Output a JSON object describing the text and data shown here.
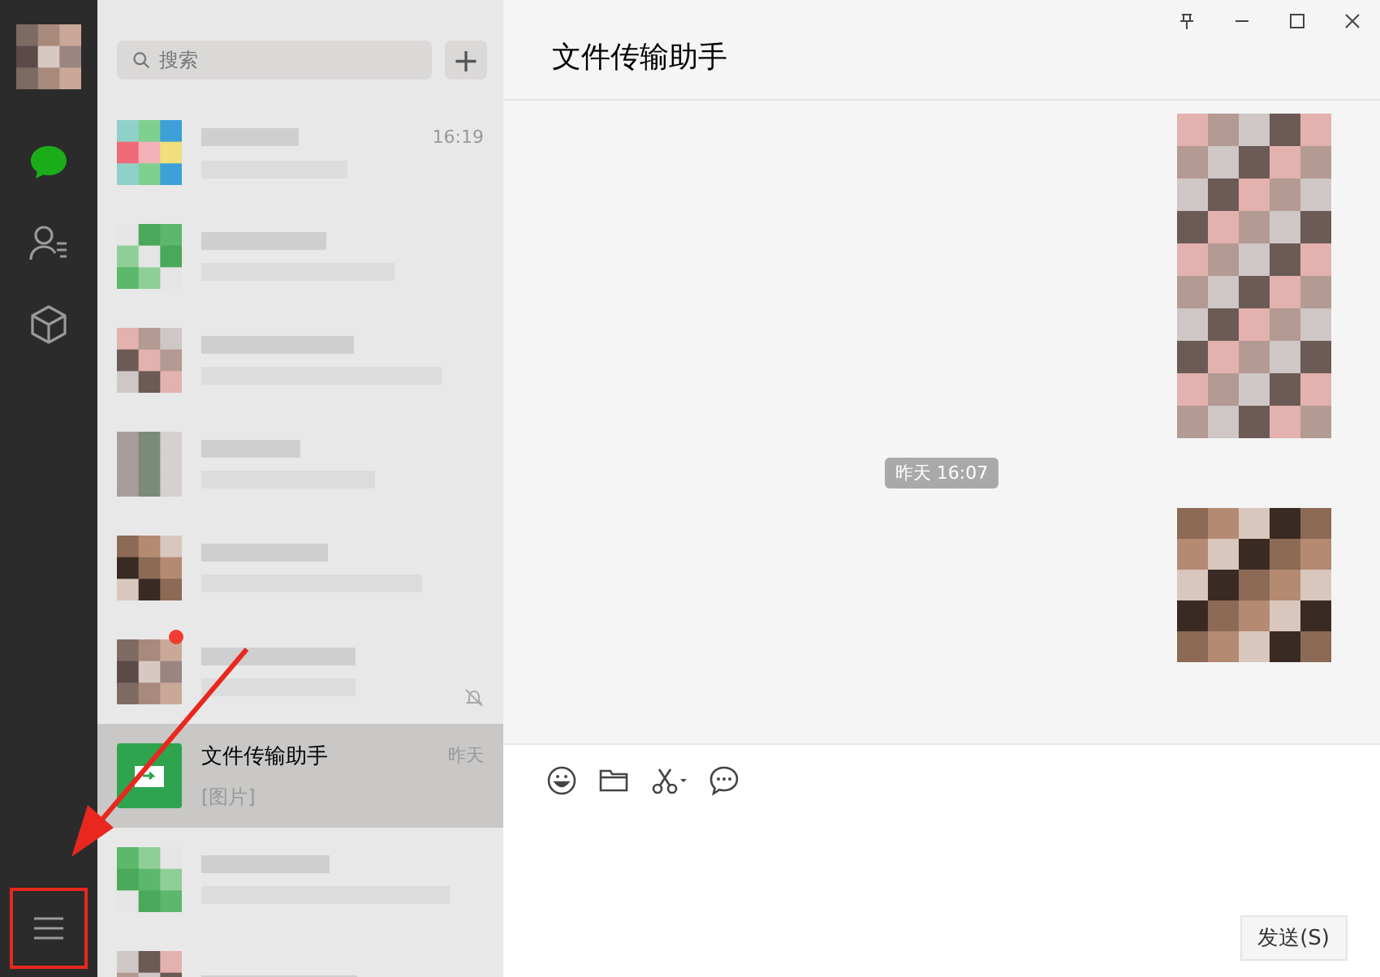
{
  "window": {
    "title": "文件传输助手",
    "controls": [
      {
        "kind": "pin"
      },
      {
        "kind": "minimize"
      },
      {
        "kind": "maximize"
      },
      {
        "kind": "close"
      }
    ]
  },
  "sidebar": {
    "items": [
      {
        "kind": "chats",
        "selected": true
      },
      {
        "kind": "contacts",
        "selected": false
      },
      {
        "kind": "favorites",
        "selected": false
      }
    ],
    "menu": {
      "highlighted": true
    }
  },
  "search": {
    "placeholder": "搜索",
    "add_button": "+"
  },
  "chats": [
    {
      "kind": "blurred",
      "selected": false,
      "time": "16:19",
      "unread": false,
      "muted": false
    },
    {
      "kind": "blurred",
      "selected": false,
      "unread": false,
      "muted": false
    },
    {
      "kind": "blurred",
      "selected": false,
      "unread": false,
      "muted": false
    },
    {
      "kind": "blurred",
      "selected": false,
      "unread": false,
      "muted": false
    },
    {
      "kind": "blurred",
      "selected": false,
      "unread": false,
      "muted": false
    },
    {
      "kind": "blurred",
      "selected": false,
      "unread": true,
      "muted": true
    },
    {
      "kind": "chat",
      "selected": true,
      "name": "文件传输助手",
      "preview": "[图片]",
      "time": "昨天",
      "unread": false,
      "muted": false
    },
    {
      "kind": "blurred",
      "selected": false,
      "unread": false,
      "muted": false
    },
    {
      "kind": "blurred_top",
      "selected": false,
      "unread": false,
      "muted": false
    }
  ],
  "messages": [
    {
      "kind": "picture"
    },
    {
      "kind": "time",
      "text": "昨天 16:07"
    },
    {
      "kind": "picture"
    }
  ],
  "toolbar": [
    {
      "kind": "emoji"
    },
    {
      "kind": "folder"
    },
    {
      "kind": "screenshot"
    },
    {
      "kind": "chat"
    }
  ],
  "send_button": "发送(S)",
  "annotation": {
    "kind": "arrow"
  }
}
